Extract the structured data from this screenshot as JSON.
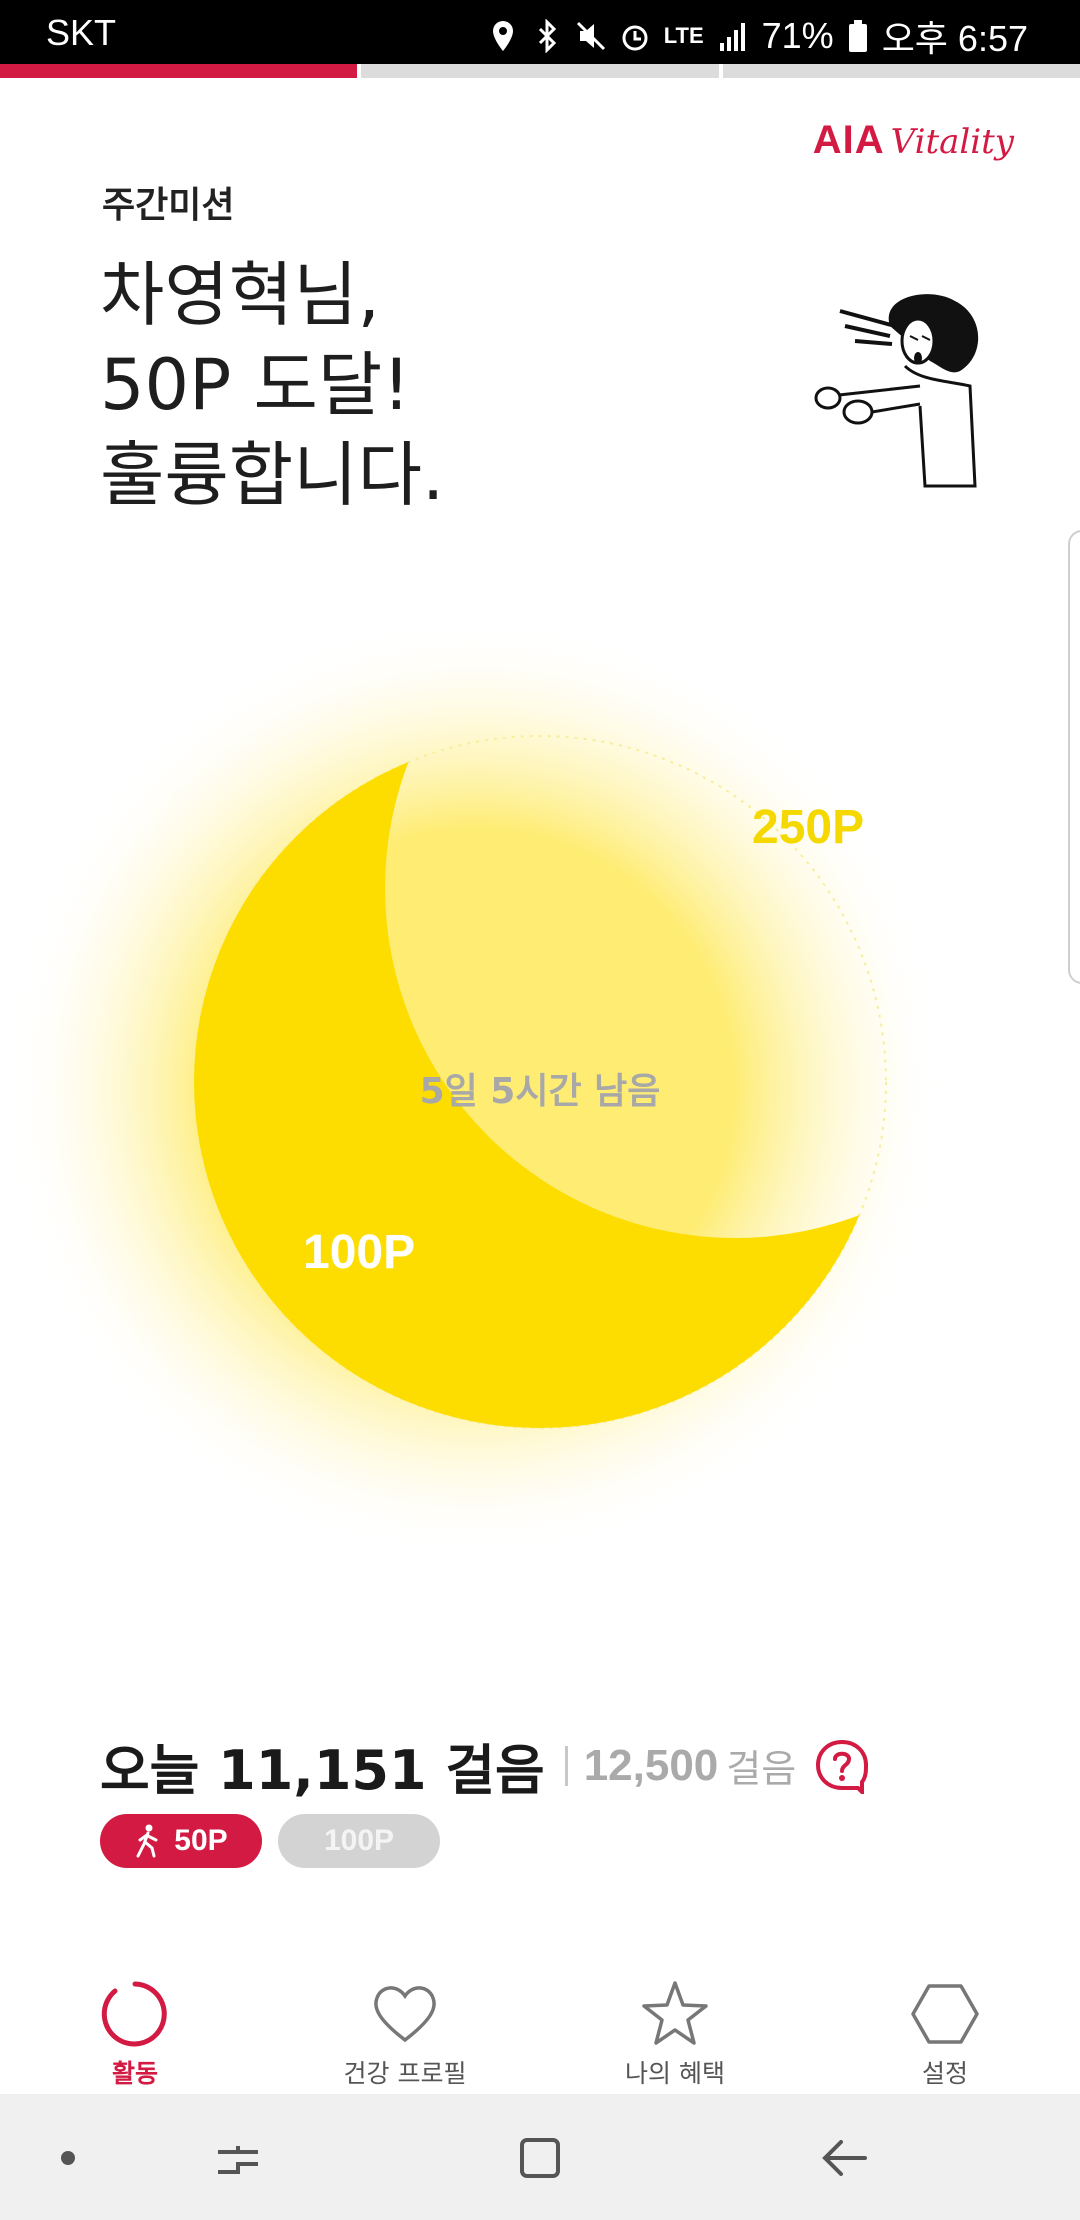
{
  "status_bar": {
    "carrier": "SKT",
    "network": "LTE",
    "battery": "71%",
    "time": "오후 6:57",
    "icons": [
      "location-icon",
      "bluetooth-icon",
      "mute-icon",
      "alarm-icon",
      "signal-icon",
      "battery-icon"
    ]
  },
  "progress": {
    "segments": 3,
    "active_index": 0
  },
  "brand": {
    "name": "AIA",
    "sub": "Vitality",
    "color": "#d21a43"
  },
  "mission": {
    "section_label": "주간미션",
    "headline": [
      "차영혁님,",
      "50P 도달!",
      "훌륭합니다."
    ]
  },
  "goal_chart": {
    "levels": [
      "250P",
      "100P"
    ],
    "remaining_text": "5일 5시간 남음",
    "color": "#fddd00"
  },
  "steps": {
    "today_label": "오늘 11,151 걸음",
    "goal_value": "12,500",
    "goal_unit": "걸음"
  },
  "pills": [
    {
      "label": "50P",
      "state": "achieved",
      "icon": "walk-icon"
    },
    {
      "label": "100P",
      "state": "pending"
    }
  ],
  "tabs": [
    {
      "label": "활동",
      "icon": "activity-ring-icon",
      "active": true
    },
    {
      "label": "건강 프로필",
      "icon": "heart-icon",
      "active": false
    },
    {
      "label": "나의 혜택",
      "icon": "star-icon",
      "active": false
    },
    {
      "label": "설정",
      "icon": "hexagon-icon",
      "active": false
    }
  ],
  "nav_buttons": [
    "dot-indicator-icon",
    "recents-icon",
    "home-icon",
    "back-icon"
  ]
}
